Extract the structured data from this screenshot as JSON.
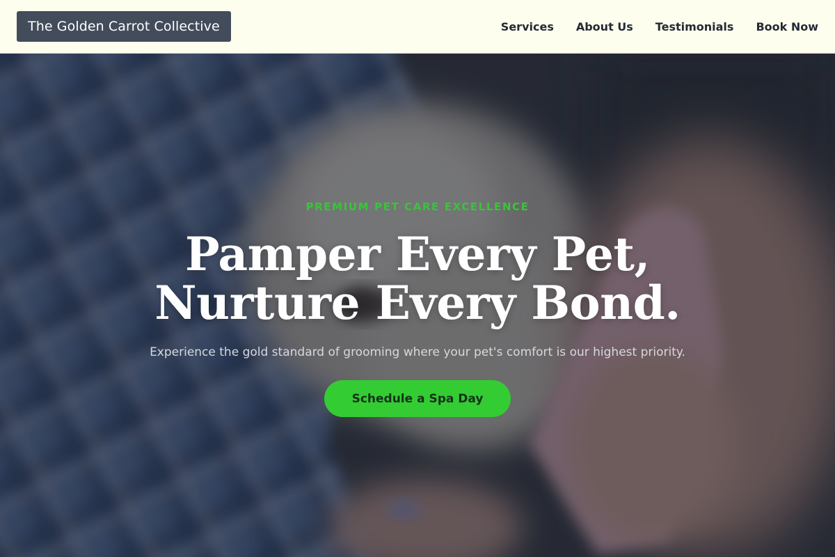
{
  "header": {
    "brand": "The Golden Carrot Collective",
    "nav": [
      "Services",
      "About Us",
      "Testimonials",
      "Book Now"
    ]
  },
  "hero": {
    "eyebrow": "PREMIUM PET CARE EXCELLENCE",
    "headline_line1": "Pamper Every Pet,",
    "headline_line2": "Nurture Every Bond.",
    "subheadline": "Experience the gold standard of grooming where your pet's comfort is our highest priority.",
    "cta": "Schedule a Spa Day"
  },
  "colors": {
    "header_bg": "#fefeee",
    "brand_bg": "#434c5b",
    "accent_green": "#33cc33",
    "eyebrow_green": "#37c636"
  }
}
